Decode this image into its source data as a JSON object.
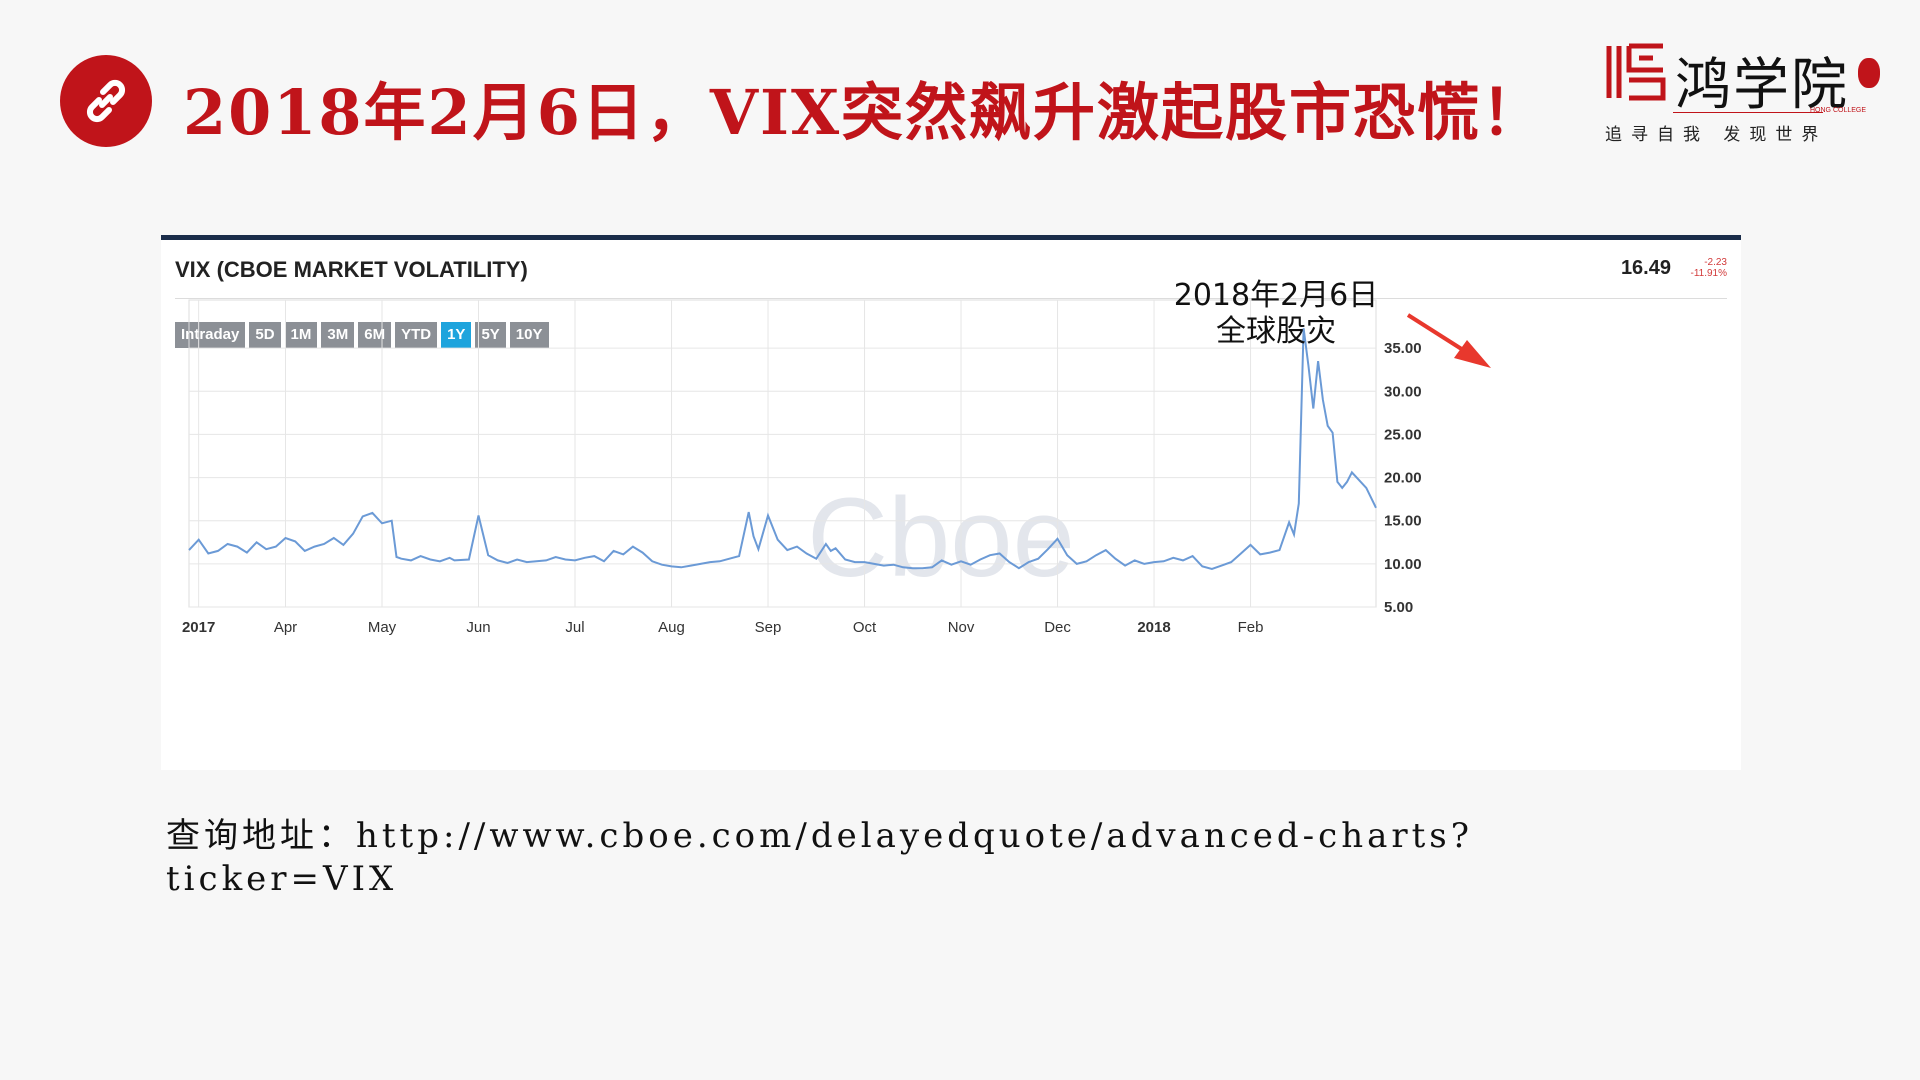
{
  "header": {
    "title": "2018年2月6日，VIX突然飙升激起股市恐慌！",
    "link_icon": "link-icon"
  },
  "logo": {
    "name": "鸿学院",
    "english": "HONG COLLEGE",
    "slogan": "追寻自我 发现世界"
  },
  "colors": {
    "accent": "#c0141a",
    "panel_border": "#1b2d4a",
    "line": "#6b9ad6",
    "active_range": "#1ea4dd",
    "arrow": "#e8382d"
  },
  "panel": {
    "name": "VIX (CBOE MARKET VOLATILITY)",
    "last_value": "16.49",
    "change": "-2.23",
    "change_pct": "-11.91%",
    "ranges": [
      "Intraday",
      "5D",
      "1M",
      "3M",
      "6M",
      "YTD",
      "1Y",
      "5Y",
      "10Y"
    ],
    "active_range": "1Y",
    "watermark": "Cboe"
  },
  "annotation": {
    "line1": "2018年2月6日",
    "line2": "全球股灾"
  },
  "footer": {
    "label": "查询地址：",
    "url": "http://www.cboe.com/delayedquote/advanced-charts?ticker=VIX"
  },
  "chart_data": {
    "type": "line",
    "title": "VIX (CBOE MARKET VOLATILITY)",
    "xlabel": "",
    "ylabel": "",
    "x_ticks": [
      "2017",
      "Apr",
      "May",
      "Jun",
      "Jul",
      "Aug",
      "Sep",
      "Oct",
      "Nov",
      "Dec",
      "2018",
      "Feb"
    ],
    "y_ticks": [
      "5.00",
      "10.00",
      "15.00",
      "20.00",
      "25.00",
      "30.00",
      "35.00"
    ],
    "ylim": [
      5,
      40
    ],
    "xlim_months": [
      2.5,
      14.8
    ],
    "grid": true,
    "series": [
      {
        "name": "",
        "points": [
          [
            2.5,
            11.6
          ],
          [
            2.6,
            12.8
          ],
          [
            2.7,
            11.2
          ],
          [
            2.8,
            11.5
          ],
          [
            2.9,
            12.3
          ],
          [
            3.0,
            12.0
          ],
          [
            3.1,
            11.3
          ],
          [
            3.2,
            12.5
          ],
          [
            3.3,
            11.7
          ],
          [
            3.4,
            12.0
          ],
          [
            3.5,
            13.0
          ],
          [
            3.6,
            12.6
          ],
          [
            3.7,
            11.5
          ],
          [
            3.8,
            12.0
          ],
          [
            3.9,
            12.3
          ],
          [
            4.0,
            13.0
          ],
          [
            4.1,
            12.2
          ],
          [
            4.2,
            13.5
          ],
          [
            4.3,
            15.5
          ],
          [
            4.4,
            15.9
          ],
          [
            4.5,
            14.7
          ],
          [
            4.6,
            15.0
          ],
          [
            4.65,
            10.8
          ],
          [
            4.7,
            10.6
          ],
          [
            4.8,
            10.4
          ],
          [
            4.9,
            10.9
          ],
          [
            5.0,
            10.5
          ],
          [
            5.1,
            10.3
          ],
          [
            5.2,
            10.7
          ],
          [
            5.25,
            10.4
          ],
          [
            5.4,
            10.5
          ],
          [
            5.5,
            15.6
          ],
          [
            5.6,
            11.0
          ],
          [
            5.7,
            10.4
          ],
          [
            5.8,
            10.1
          ],
          [
            5.9,
            10.5
          ],
          [
            6.0,
            10.2
          ],
          [
            6.1,
            10.3
          ],
          [
            6.2,
            10.4
          ],
          [
            6.3,
            10.8
          ],
          [
            6.4,
            10.5
          ],
          [
            6.5,
            10.4
          ],
          [
            6.6,
            10.7
          ],
          [
            6.7,
            10.9
          ],
          [
            6.8,
            10.3
          ],
          [
            6.9,
            11.5
          ],
          [
            7.0,
            11.1
          ],
          [
            7.1,
            12.0
          ],
          [
            7.2,
            11.3
          ],
          [
            7.3,
            10.3
          ],
          [
            7.4,
            9.9
          ],
          [
            7.5,
            9.7
          ],
          [
            7.6,
            9.6
          ],
          [
            7.7,
            9.8
          ],
          [
            7.8,
            10.0
          ],
          [
            7.9,
            10.2
          ],
          [
            8.0,
            10.3
          ],
          [
            8.1,
            10.6
          ],
          [
            8.2,
            10.9
          ],
          [
            8.3,
            16.0
          ],
          [
            8.35,
            13.2
          ],
          [
            8.4,
            11.7
          ],
          [
            8.5,
            15.6
          ],
          [
            8.6,
            12.8
          ],
          [
            8.7,
            11.6
          ],
          [
            8.8,
            12.0
          ],
          [
            8.9,
            11.2
          ],
          [
            9.0,
            10.6
          ],
          [
            9.1,
            12.3
          ],
          [
            9.15,
            11.5
          ],
          [
            9.2,
            11.8
          ],
          [
            9.3,
            10.5
          ],
          [
            9.4,
            10.2
          ],
          [
            9.5,
            10.2
          ],
          [
            9.6,
            10.0
          ],
          [
            9.7,
            9.8
          ],
          [
            9.8,
            9.9
          ],
          [
            9.9,
            9.6
          ],
          [
            10.0,
            9.5
          ],
          [
            10.1,
            9.5
          ],
          [
            10.2,
            9.6
          ],
          [
            10.3,
            10.4
          ],
          [
            10.4,
            9.9
          ],
          [
            10.5,
            10.3
          ],
          [
            10.6,
            9.9
          ],
          [
            10.7,
            10.5
          ],
          [
            10.8,
            11.0
          ],
          [
            10.9,
            11.2
          ],
          [
            11.0,
            10.2
          ],
          [
            11.1,
            9.5
          ],
          [
            11.2,
            10.2
          ],
          [
            11.3,
            10.6
          ],
          [
            11.4,
            11.7
          ],
          [
            11.5,
            12.9
          ],
          [
            11.6,
            11.0
          ],
          [
            11.7,
            10.0
          ],
          [
            11.8,
            10.3
          ],
          [
            11.9,
            11.0
          ],
          [
            12.0,
            11.6
          ],
          [
            12.1,
            10.6
          ],
          [
            12.2,
            9.8
          ],
          [
            12.3,
            10.4
          ],
          [
            12.4,
            10.0
          ],
          [
            12.5,
            10.2
          ],
          [
            12.6,
            10.3
          ],
          [
            12.7,
            10.7
          ],
          [
            12.8,
            10.4
          ],
          [
            12.9,
            10.9
          ],
          [
            13.0,
            9.7
          ],
          [
            13.1,
            9.4
          ],
          [
            13.2,
            9.8
          ],
          [
            13.3,
            10.2
          ],
          [
            13.4,
            11.2
          ],
          [
            13.5,
            12.2
          ],
          [
            13.6,
            11.1
          ],
          [
            13.7,
            11.3
          ],
          [
            13.8,
            11.6
          ],
          [
            13.9,
            14.8
          ],
          [
            13.95,
            13.4
          ],
          [
            14.0,
            17.0
          ],
          [
            14.05,
            37.3
          ],
          [
            14.1,
            33.0
          ],
          [
            14.15,
            28.0
          ],
          [
            14.2,
            33.5
          ],
          [
            14.25,
            29.0
          ],
          [
            14.3,
            26.0
          ],
          [
            14.35,
            25.2
          ],
          [
            14.4,
            19.5
          ],
          [
            14.45,
            18.8
          ],
          [
            14.5,
            19.5
          ],
          [
            14.55,
            20.6
          ],
          [
            14.6,
            20.0
          ],
          [
            14.7,
            18.8
          ],
          [
            14.8,
            16.5
          ]
        ]
      }
    ]
  }
}
